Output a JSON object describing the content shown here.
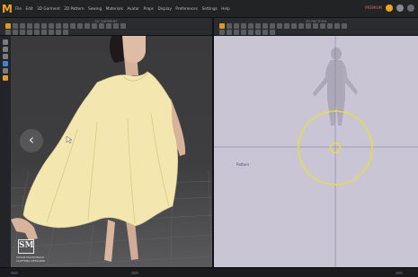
{
  "app": {
    "logo_glyph": "M",
    "brand_color": "#f2a51c"
  },
  "menu": {
    "items": [
      "File",
      "Edit",
      "3D Garment",
      "2D Pattern",
      "Sewing",
      "Materials",
      "Avatar",
      "Props",
      "Display",
      "Preferences",
      "Settings",
      "Help"
    ]
  },
  "menu_right": {
    "status": "PREMIUM"
  },
  "toolbar": {
    "left_title": "3D GARMENT",
    "right_title": "2D PATTERN"
  },
  "pattern_window": {
    "pattern_label": "Pattern"
  },
  "watermark": {
    "logo": "SM",
    "line1": "SUSAN MACDONALD",
    "line2": "CLOTHING DESIGNER"
  },
  "navigation": {
    "back_glyph": "‹"
  },
  "colors": {
    "garment": "#f3e6ae",
    "selection": "#f0e020",
    "pattern_bg": "#c9c5d4",
    "viewport_bg": "#3c3c3e"
  }
}
